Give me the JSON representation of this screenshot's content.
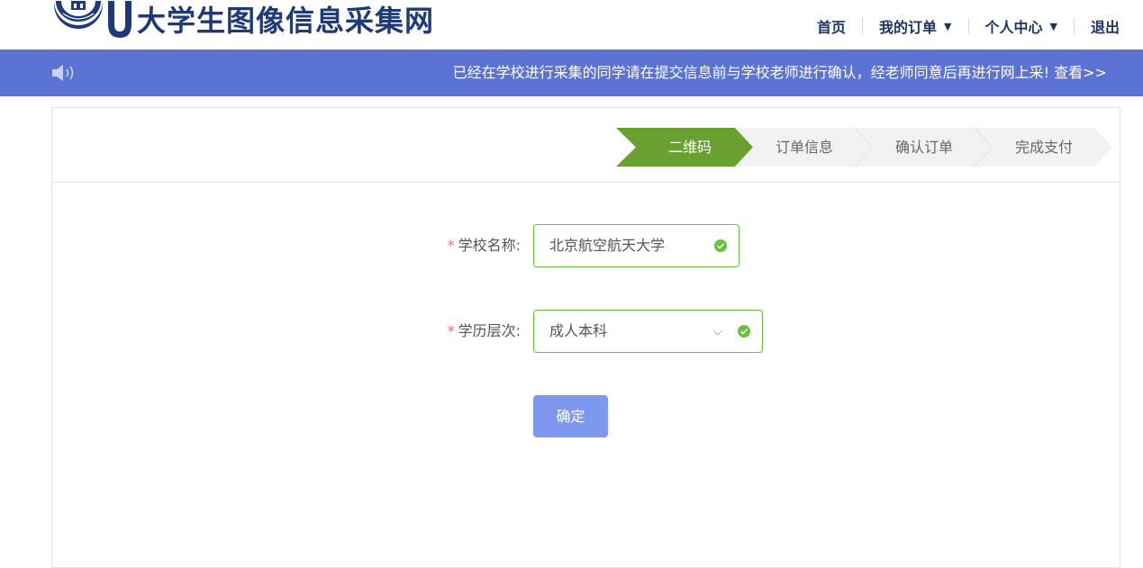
{
  "site": {
    "title": "大学生图像信息采集网"
  },
  "nav": {
    "home": "首页",
    "orders": "我的订单",
    "profile": "个人中心",
    "logout": "退出"
  },
  "notice": {
    "message": "已经在学校进行采集的同学请在提交信息前与学校老师进行确认，经老师同意后再进行网上采!",
    "more": "查看>>"
  },
  "steps": [
    {
      "label": "二维码",
      "active": true
    },
    {
      "label": "订单信息",
      "active": false
    },
    {
      "label": "确认订单",
      "active": false
    },
    {
      "label": "完成支付",
      "active": false
    }
  ],
  "form": {
    "school": {
      "label": "学校名称:",
      "value": "北京航空航天大学"
    },
    "level": {
      "label": "学历层次:",
      "value": "成人本科"
    },
    "required_mark": "*",
    "submit": "确定"
  },
  "colors": {
    "brand": "#5b73d3",
    "step_active": "#6aa02f",
    "step_inactive": "#f2f2f2",
    "valid": "#67c23a",
    "button": "#7f98ef",
    "required": "#f56c6c"
  }
}
